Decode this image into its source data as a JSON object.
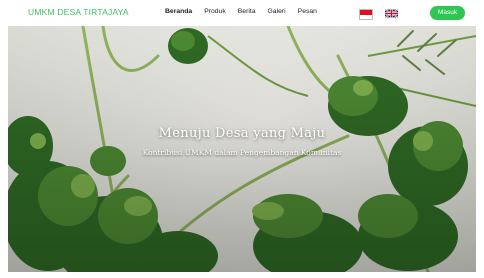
{
  "navbar": {
    "brand": "UMKM DESA TIRTAJAYA",
    "menu": [
      "Beranda",
      "Produk",
      "Berita",
      "Galeri",
      "Pesan"
    ],
    "active_index": 0,
    "login_label": "Masuk"
  },
  "languages": [
    "indonesian-flag-icon",
    "uk-flag-icon"
  ],
  "hero": {
    "title": "Menuju Desa yang Maju",
    "subtitle": "Kontribusi UMKM dalam Pengembangan Komunitas"
  },
  "colors": {
    "brand": "#3cbf63",
    "button": "#2dc653",
    "hero_background": "#ecebe6",
    "leaf_dark": "#2f6a24",
    "leaf_light": "#7fb24d"
  }
}
